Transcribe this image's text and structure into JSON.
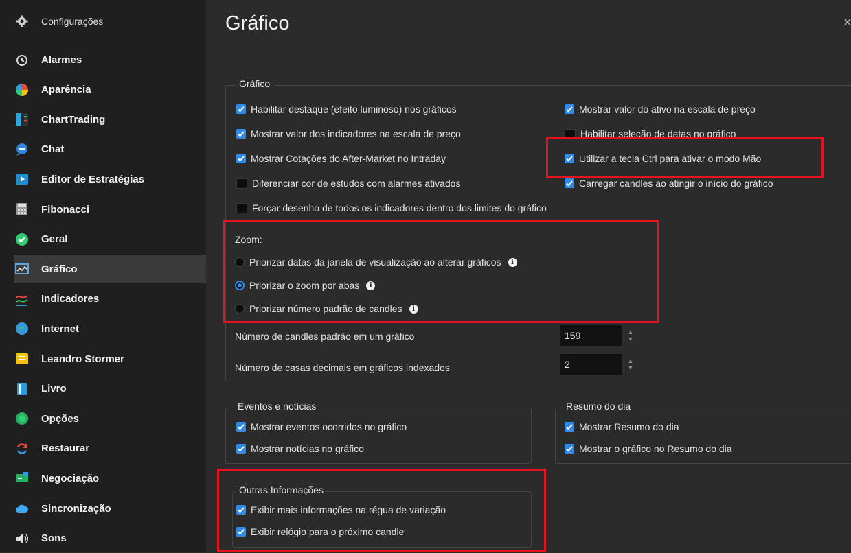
{
  "sidebar": {
    "header": {
      "label": "Configurações",
      "icon": "gear-icon"
    },
    "items": [
      {
        "label": "Alarmes",
        "icon": "alarm-clock-icon",
        "color": "#dddddd"
      },
      {
        "label": "Aparência",
        "icon": "color-wheel-icon",
        "color": "#f2a71b"
      },
      {
        "label": "ChartTrading",
        "icon": "chart-trading-icon",
        "color": "#29a8e0"
      },
      {
        "label": "Chat",
        "icon": "chat-bubble-icon",
        "color": "#2e86de"
      },
      {
        "label": "Editor de Estratégias",
        "icon": "play-editor-icon",
        "color": "#1f8fcf"
      },
      {
        "label": "Fibonacci",
        "icon": "calculator-icon",
        "color": "#9a9a9a"
      },
      {
        "label": "Geral",
        "icon": "check-circle-icon",
        "color": "#2ecc71"
      },
      {
        "label": "Gráfico",
        "icon": "chart-window-icon",
        "color": "#5fa8e8",
        "active": true
      },
      {
        "label": "Indicadores",
        "icon": "indicator-lines-icon",
        "color": "#e74c3c"
      },
      {
        "label": "Internet",
        "icon": "globe-icon",
        "color": "#3498db"
      },
      {
        "label": "Leandro Stormer",
        "icon": "message-box-icon",
        "color": "#f1c40f"
      },
      {
        "label": "Livro",
        "icon": "book-icon",
        "color": "#2b9be0"
      },
      {
        "label": "Opções",
        "icon": "green-circle-icon",
        "color": "#27ae60"
      },
      {
        "label": "Restaurar",
        "icon": "refresh-icon",
        "color": "#e74c3c"
      },
      {
        "label": "Negociação",
        "icon": "trade-icon",
        "color": "#27ae60"
      },
      {
        "label": "Sincronização",
        "icon": "cloud-icon",
        "color": "#3fa9f5"
      },
      {
        "label": "Sons",
        "icon": "speaker-icon",
        "color": "#dddddd"
      }
    ]
  },
  "main": {
    "title": "Gráfico",
    "close_glyph": "×",
    "grafico_group": {
      "title": "Gráfico",
      "left_options": [
        {
          "label": "Habilitar destaque (efeito luminoso) nos gráficos",
          "checked": true
        },
        {
          "label": "Mostrar valor dos indicadores na escala de preço",
          "checked": true
        },
        {
          "label": "Mostrar Cotações do After-Market no Intraday",
          "checked": true
        },
        {
          "label": "Diferenciar cor de estudos com alarmes ativados",
          "checked": false
        },
        {
          "label": "Forçar desenho de todos os indicadores dentro dos limites do gráfico",
          "checked": false
        }
      ],
      "right_options": [
        {
          "label": "Mostrar valor do ativo na escala de preço",
          "checked": true
        },
        {
          "label": "Habilitar seleção de datas no gráfico",
          "checked": false
        },
        {
          "label": "Utilizar a tecla Ctrl para ativar o modo Mão",
          "checked": true
        },
        {
          "label": "Carregar candles ao atingir o início do gráfico",
          "checked": true
        }
      ],
      "zoom": {
        "label": "Zoom:",
        "options": [
          {
            "label": "Priorizar datas da janela de visualização ao alterar gráficos",
            "selected": false
          },
          {
            "label": "Priorizar o zoom por abas",
            "selected": true
          },
          {
            "label": "Priorizar número padrão de candles",
            "selected": false
          }
        ]
      },
      "candles_label": "Número de candles padrão em um gráfico",
      "candles_value": "159",
      "decimals_label": "Número de casas decimais em gráficos indexados",
      "decimals_value": "2"
    },
    "eventos_group": {
      "title": "Eventos e notícias",
      "options": [
        {
          "label": "Mostrar eventos ocorridos no gráfico",
          "checked": true
        },
        {
          "label": "Mostrar notícias no gráfico",
          "checked": true
        }
      ]
    },
    "resumo_group": {
      "title": "Resumo do dia",
      "options": [
        {
          "label": "Mostrar Resumo do dia",
          "checked": true
        },
        {
          "label": "Mostrar o gráfico no Resumo do dia",
          "checked": true
        }
      ]
    },
    "outras_group": {
      "title": "Outras Informações",
      "options": [
        {
          "label": "Exibir mais informações na régua de variação",
          "checked": true
        },
        {
          "label": "Exibir relógio para o próximo candle",
          "checked": true
        }
      ]
    }
  },
  "colors": {
    "accent": "#2f8be6",
    "highlight": "#e8121e",
    "sidebar_bg": "#1f1f1f",
    "main_bg": "#2b2b2b"
  }
}
